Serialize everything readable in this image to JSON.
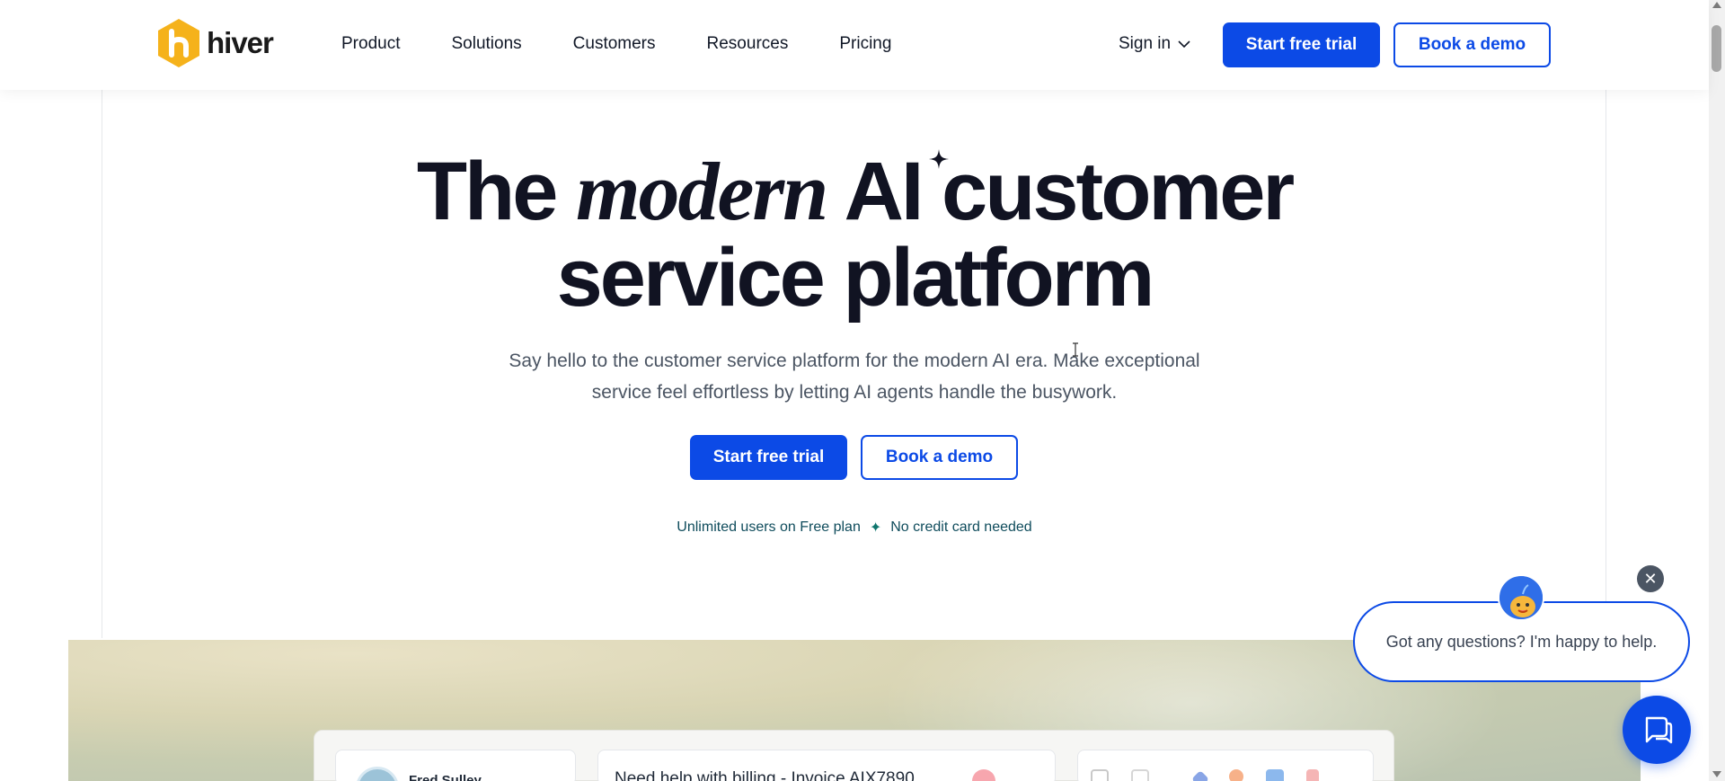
{
  "nav": {
    "logo_text": "hiver",
    "links": [
      "Product",
      "Solutions",
      "Customers",
      "Resources",
      "Pricing"
    ],
    "signin_label": "Sign in",
    "trial_label": "Start free trial",
    "demo_label": "Book a demo"
  },
  "hero": {
    "title_word1": "The",
    "title_italic": "modern",
    "title_word3": "AI customer",
    "title_line2": "service platform",
    "subtitle_line1": "Say hello to the customer service platform for the modern AI era. Make exceptional",
    "subtitle_line2": "service feel effortless by letting AI agents handle the busywork.",
    "trial_label": "Start free trial",
    "demo_label": "Book a demo",
    "note_left": "Unlimited users on Free plan",
    "note_star": "✦",
    "note_right": "No credit card needed"
  },
  "preview": {
    "contact_name": "Fred Sulley",
    "ticket_title": "Need help with billing - Invoice AIX7890"
  },
  "chat": {
    "message": "Got any questions? I'm happy to help.",
    "close_glyph": "✕"
  },
  "colors": {
    "brand_blue": "#0c4ae6",
    "logo_orange": "#f5b21b",
    "heading": "#111322"
  },
  "icons": [
    "hiver-logo-icon",
    "chevron-down-icon",
    "sparkle-icon",
    "close-icon",
    "chat-icon"
  ]
}
